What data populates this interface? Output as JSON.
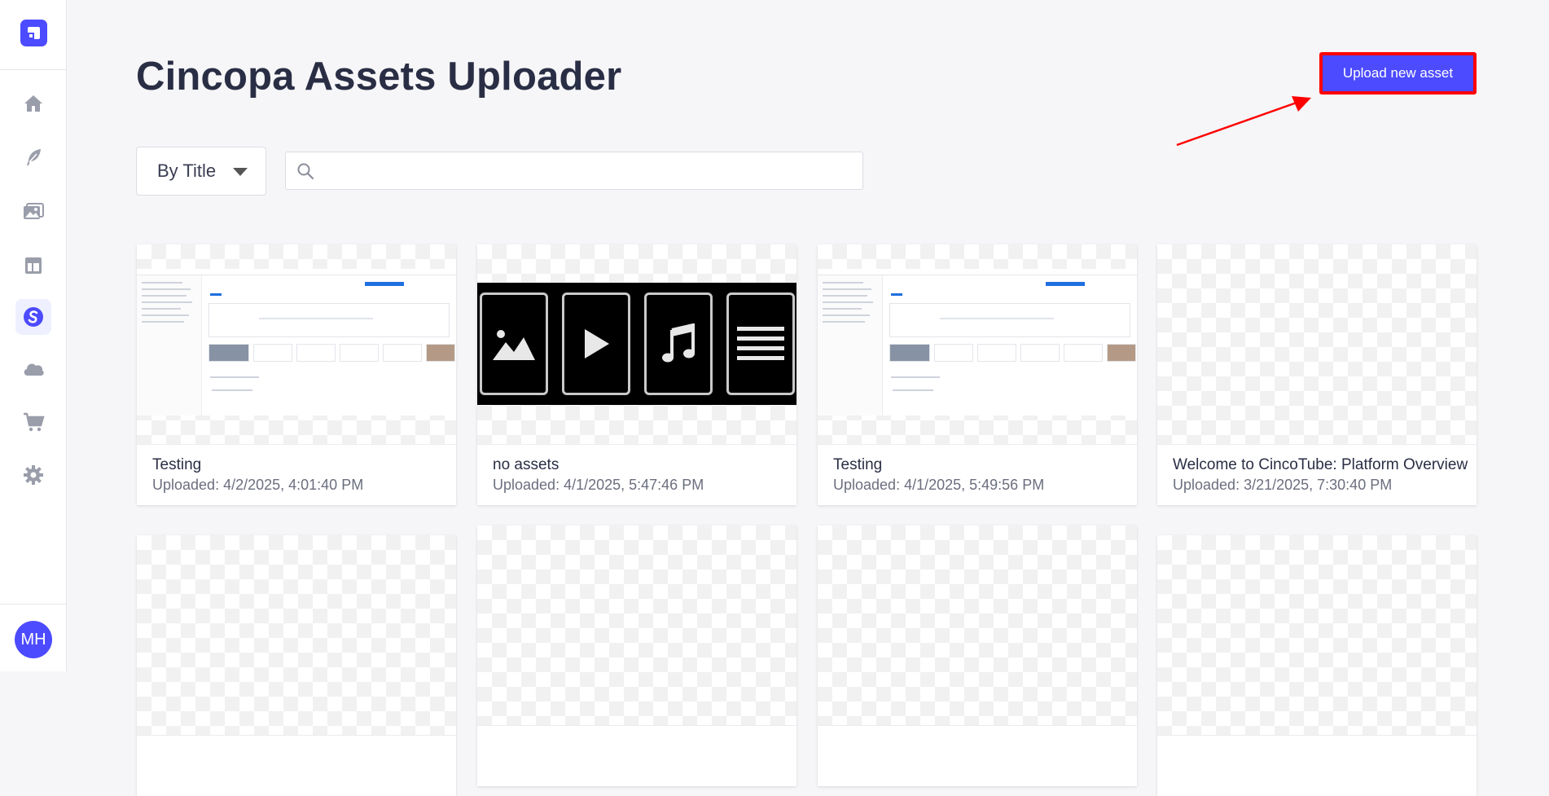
{
  "sidebar": {
    "logo_icon": "cincopa-logo-icon",
    "items": [
      {
        "icon": "home-icon",
        "name": "Home"
      },
      {
        "icon": "feather-icon",
        "name": "Create"
      },
      {
        "icon": "images-icon",
        "name": "Media"
      },
      {
        "icon": "layout-icon",
        "name": "Templates"
      },
      {
        "icon": "cincopa-s-icon",
        "name": "Cincopa",
        "active": true
      },
      {
        "icon": "cloud-icon",
        "name": "Cloud"
      },
      {
        "icon": "cart-icon",
        "name": "Store"
      },
      {
        "icon": "gear-icon",
        "name": "Settings"
      }
    ],
    "avatar_initials": "MH"
  },
  "header": {
    "title": "Cincopa Assets Uploader",
    "upload_button_label": "Upload new asset"
  },
  "filters": {
    "sort_value": "By Title",
    "search_placeholder": ""
  },
  "colors": {
    "accent": "#4c4bff",
    "highlight_border": "#ff0000",
    "annotation_arrow": "#ff0000"
  },
  "assets": [
    {
      "title": "Testing",
      "uploaded": "Uploaded: 4/2/2025, 4:01:40 PM",
      "thumbnail": "dashboard-screenshot"
    },
    {
      "title": "no assets",
      "uploaded": "Uploaded: 4/1/2025, 5:47:46 PM",
      "thumbnail": "media-types-image"
    },
    {
      "title": "Testing",
      "uploaded": "Uploaded: 4/1/2025, 5:49:56 PM",
      "thumbnail": "dashboard-screenshot"
    },
    {
      "title": "Welcome to CincoTube: Platform Overview",
      "uploaded": "Uploaded: 3/21/2025, 7:30:40 PM",
      "thumbnail": "transparent-placeholder"
    },
    {
      "title": "",
      "uploaded": "",
      "thumbnail": "transparent-placeholder"
    },
    {
      "title": "",
      "uploaded": "",
      "thumbnail": "transparent-placeholder"
    },
    {
      "title": "",
      "uploaded": "",
      "thumbnail": "transparent-placeholder"
    },
    {
      "title": "",
      "uploaded": "",
      "thumbnail": "transparent-placeholder"
    }
  ]
}
